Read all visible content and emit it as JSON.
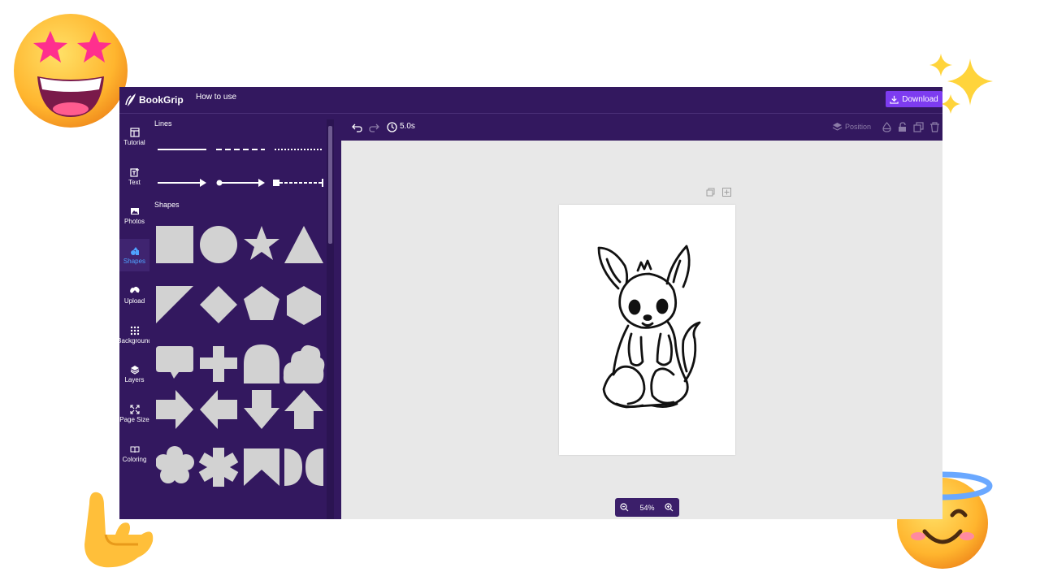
{
  "app": {
    "brand": "BookGrip",
    "nav_link": "How to use",
    "download_label": "Download"
  },
  "rail": {
    "items": [
      {
        "label": "Tutorial",
        "icon": "tutorial-icon"
      },
      {
        "label": "Text",
        "icon": "text-icon"
      },
      {
        "label": "Photos",
        "icon": "photos-icon"
      },
      {
        "label": "Shapes",
        "icon": "shapes-icon",
        "active": true
      },
      {
        "label": "Upload",
        "icon": "upload-icon"
      },
      {
        "label": "Background",
        "icon": "background-icon"
      },
      {
        "label": "Layers",
        "icon": "layers-icon"
      },
      {
        "label": "Page Size",
        "icon": "page-size-icon"
      },
      {
        "label": "Coloring",
        "icon": "coloring-icon"
      }
    ]
  },
  "panel": {
    "lines_title": "Lines",
    "shapes_title": "Shapes",
    "lines": [
      "solid-line",
      "dashed-line",
      "dotted-line",
      "arrow-line",
      "dot-arrow-line",
      "square-dashed-line"
    ],
    "shapes": [
      "square",
      "circle",
      "star",
      "triangle",
      "right-triangle",
      "diamond",
      "pentagon",
      "hexagon",
      "speech-bubble",
      "cross",
      "arch",
      "cloud",
      "arrow-right",
      "arrow-left",
      "arrow-down",
      "arrow-up",
      "flower",
      "asterisk",
      "bookmark",
      "half-circles"
    ]
  },
  "toolbar": {
    "timer": "5.0s",
    "position_label": "Position"
  },
  "zoom": {
    "level": "54%"
  },
  "colors": {
    "primary": "#33185f",
    "accent": "#7d3cf0",
    "shape_fill": "#d2d2d2",
    "canvas_bg": "#e8e8e8",
    "active_rail": "#4fa3ff"
  }
}
